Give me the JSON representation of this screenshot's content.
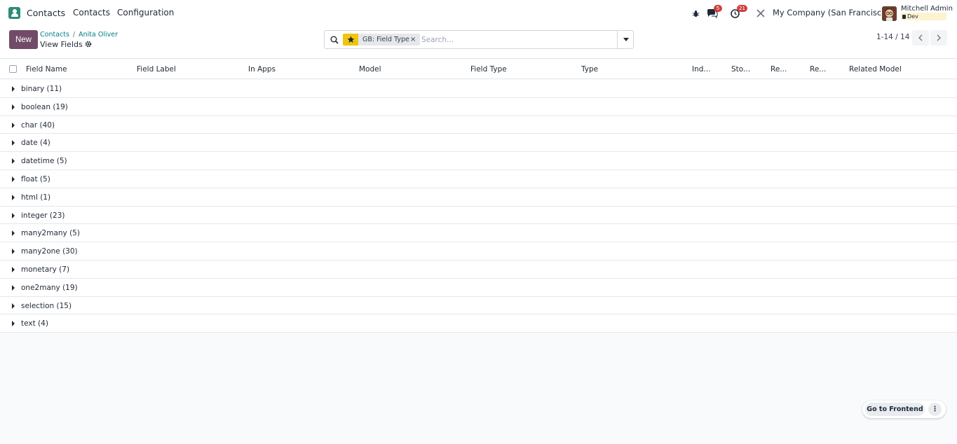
{
  "navbar": {
    "app_name": "Contacts",
    "menu": [
      "Contacts",
      "Configuration"
    ],
    "messages_count": "5",
    "activities_count": "21",
    "company": "My Company (San Francisco)",
    "user_name": "Mitchell Admin",
    "db_label": "Dev"
  },
  "control": {
    "new_label": "New",
    "breadcrumb": [
      "Contacts",
      "Anita Oliver"
    ],
    "title": "View Fields",
    "facet_value": "GB: Field Type",
    "search_placeholder": "Search...",
    "pager": "1-14 / 14"
  },
  "table": {
    "columns": [
      "Field Name",
      "Field Label",
      "In Apps",
      "Model",
      "Field Type",
      "Type",
      "Ind...",
      "Sto...",
      "Re...",
      "Re...",
      "Related Model"
    ],
    "groups": [
      "binary (11)",
      "boolean (19)",
      "char (40)",
      "date (4)",
      "datetime (5)",
      "float (5)",
      "html (1)",
      "integer (23)",
      "many2many (5)",
      "many2one (30)",
      "monetary (7)",
      "one2many (19)",
      "selection (15)",
      "text (4)"
    ]
  },
  "footer": {
    "frontend_label": "Go to Frontend"
  },
  "colors": {
    "primary": "#714b67",
    "link": "#017e84",
    "badge": "#d43d3d",
    "favorite": "#f1c40f"
  }
}
